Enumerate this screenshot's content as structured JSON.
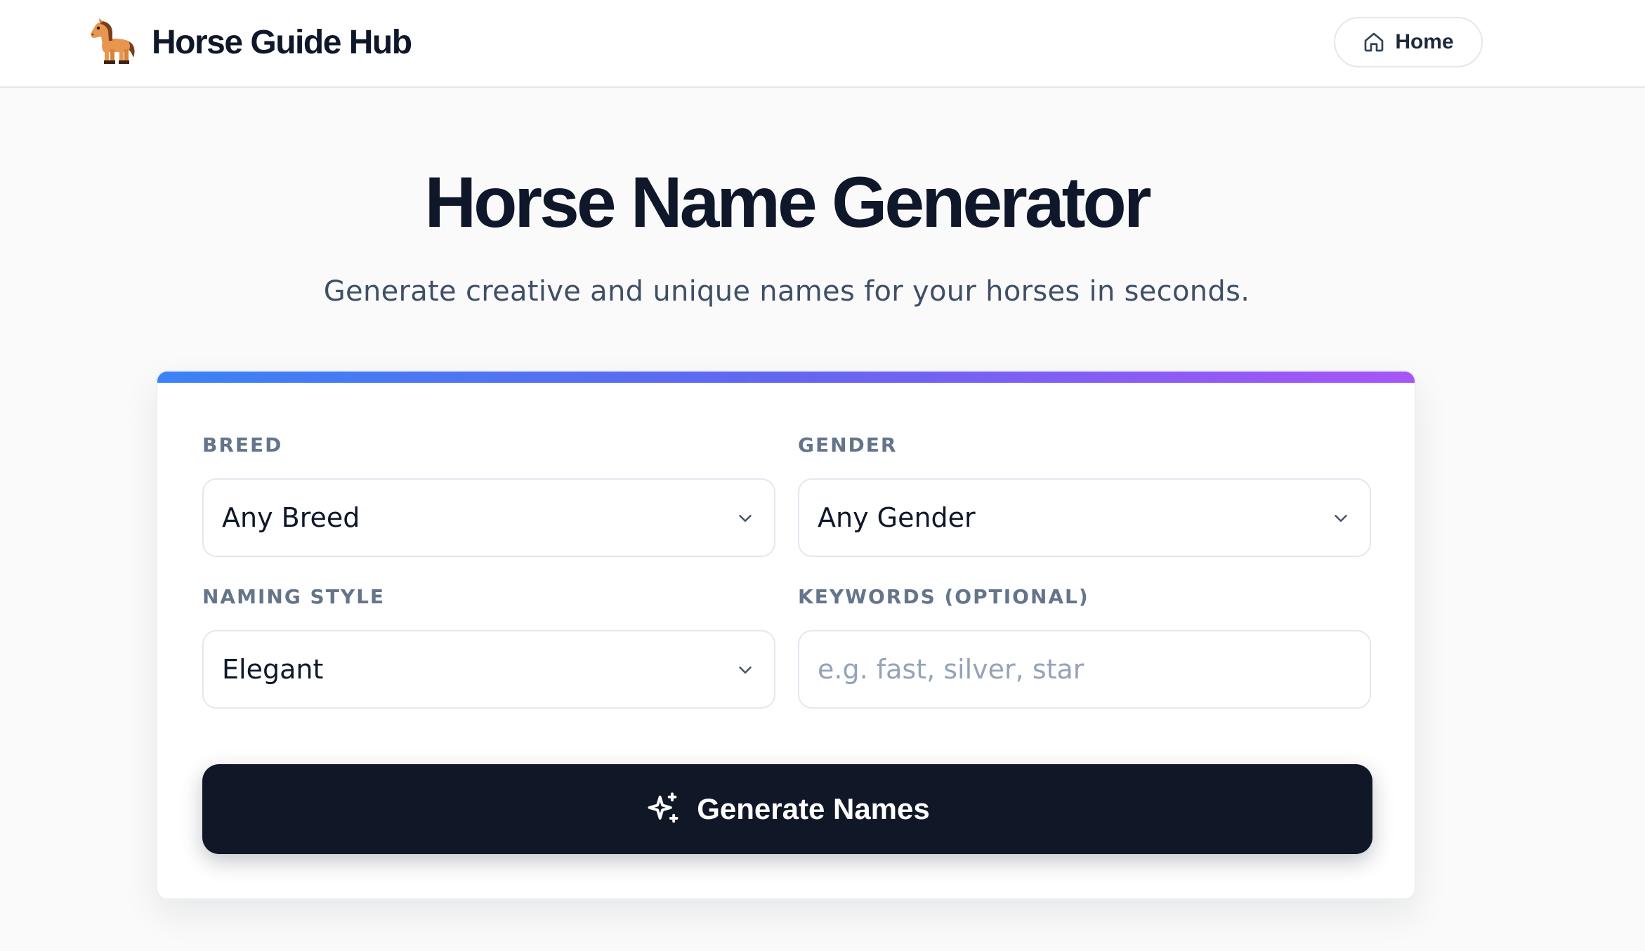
{
  "header": {
    "brand_name": "Horse Guide Hub",
    "logo_icon": "horse-icon",
    "home_label": "Home",
    "home_icon": "home-icon"
  },
  "hero": {
    "title": "Horse Name Generator",
    "subtitle": "Generate creative and unique names for your horses in seconds."
  },
  "form": {
    "accent_gradient": [
      "#3b82f6",
      "#6366f1",
      "#a855f7"
    ],
    "breed": {
      "label": "BREED",
      "value": "Any Breed"
    },
    "gender": {
      "label": "GENDER",
      "value": "Any Gender"
    },
    "naming_style": {
      "label": "NAMING STYLE",
      "value": "Elegant"
    },
    "keywords": {
      "label": "KEYWORDS (OPTIONAL)",
      "value": "",
      "placeholder": "e.g. fast, silver, star"
    },
    "generate_label": "Generate Names",
    "generate_icon": "sparkles-icon",
    "button_color": "#101828"
  }
}
